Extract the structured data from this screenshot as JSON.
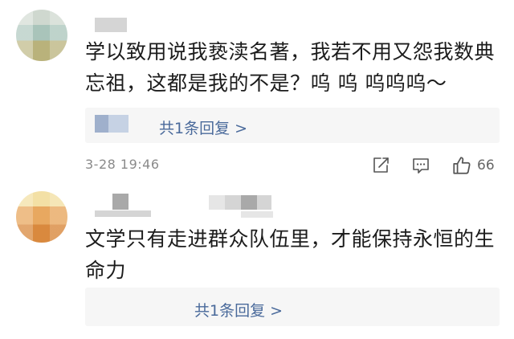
{
  "comments": [
    {
      "text": "学以致用说我亵渎名著，我若不用又怨我数典忘祖，这都是我的不是？呜 呜 呜呜呜～",
      "reply_label": "共1条回复 >",
      "timestamp": "3-28 19:46",
      "like_count": "66"
    },
    {
      "text": "文学只有走进群众队伍里，才能保持永恒的生命力",
      "reply_label": "共1条回复 >"
    }
  ],
  "icons": {
    "share": "share-icon",
    "comment": "comment-icon",
    "like": "thumbs-up-icon"
  },
  "colors": {
    "link": "#4a6a9b",
    "muted": "#8a8a8a",
    "reply_bg": "#f6f6f6"
  }
}
